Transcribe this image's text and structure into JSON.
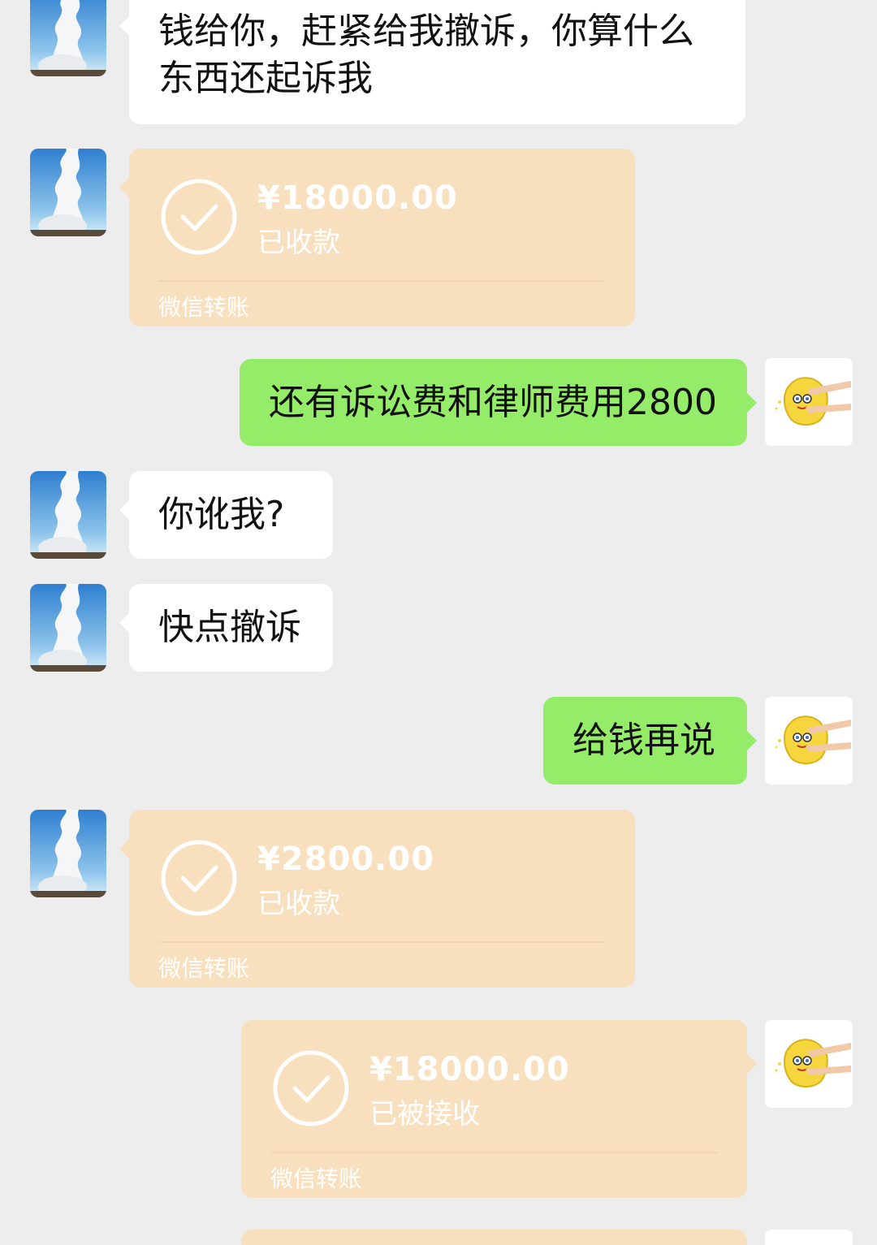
{
  "messages": [
    {
      "side": "left",
      "type": "text",
      "text": "钱给你，赶紧给我撤诉，你算什么东西还起诉我"
    },
    {
      "side": "left",
      "type": "transfer",
      "amount": "¥18000.00",
      "status": "已收款",
      "footer": "微信转账"
    },
    {
      "side": "right",
      "type": "text",
      "text": "还有诉讼费和律师费用2800"
    },
    {
      "side": "left",
      "type": "text",
      "text": "你讹我?"
    },
    {
      "side": "left",
      "type": "text",
      "text": "快点撤诉"
    },
    {
      "side": "right",
      "type": "text",
      "text": "给钱再说"
    },
    {
      "side": "left",
      "type": "transfer",
      "amount": "¥2800.00",
      "status": "已收款",
      "footer": "微信转账"
    },
    {
      "side": "right",
      "type": "transfer",
      "amount": "¥18000.00",
      "status": "已被接收",
      "footer": "微信转账"
    }
  ],
  "avatars": {
    "other": "cloud-tower-avatar",
    "me": "yellow-sponge-avatar"
  },
  "colors": {
    "background": "#ededed",
    "incoming_bubble": "#ffffff",
    "outgoing_bubble": "#95ec69",
    "transfer_card": "#f8e0bf"
  }
}
